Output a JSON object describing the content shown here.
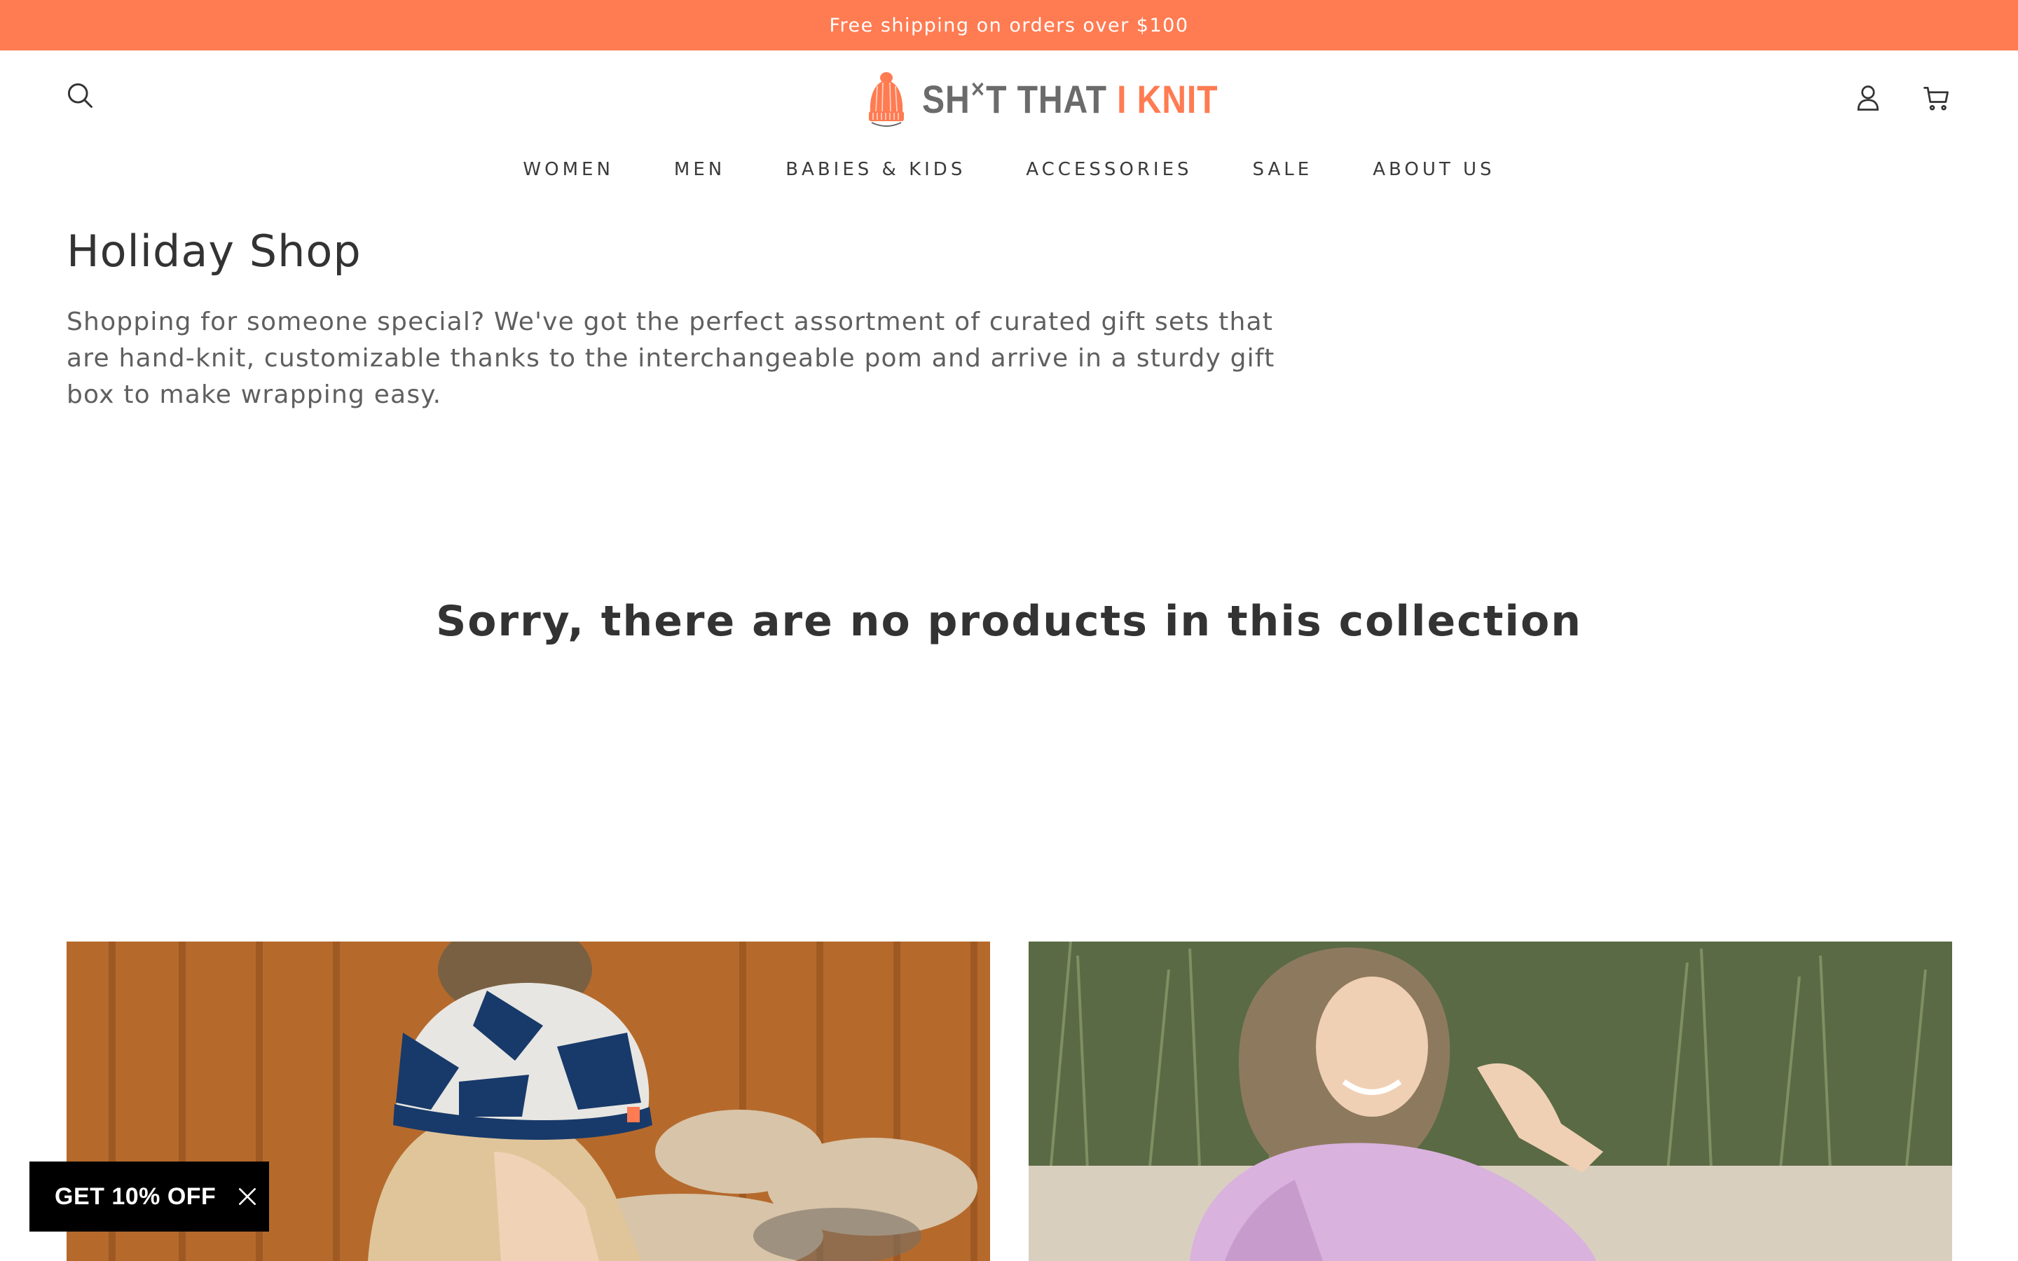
{
  "announcement": {
    "text": "Free shipping on orders over $100"
  },
  "header": {
    "logo": {
      "text_grey": "SH",
      "text_mid": "T THAT ",
      "text_orange": "I KNIT",
      "alt": "SH*T THAT I KNIT"
    },
    "icons": {
      "search": "search-icon",
      "account": "user-icon",
      "cart": "cart-icon"
    }
  },
  "nav": {
    "items": [
      "WOMEN",
      "MEN",
      "BABIES & KIDS",
      "ACCESSORIES",
      "SALE",
      "ABOUT US"
    ]
  },
  "collection": {
    "title": "Holiday Shop",
    "description": "Shopping for someone special? We've got the perfect assortment of curated gift sets that are hand-knit, customizable thanks to the interchangeable pom and arrive in a sturdy gift box to make wrapping easy.",
    "empty_message": "Sorry, there are no products in this collection"
  },
  "promo": {
    "label": "GET 10% OFF"
  },
  "colors": {
    "accent": "#ff7b52",
    "text": "#3a3a3a",
    "promo_bg": "#000000"
  }
}
